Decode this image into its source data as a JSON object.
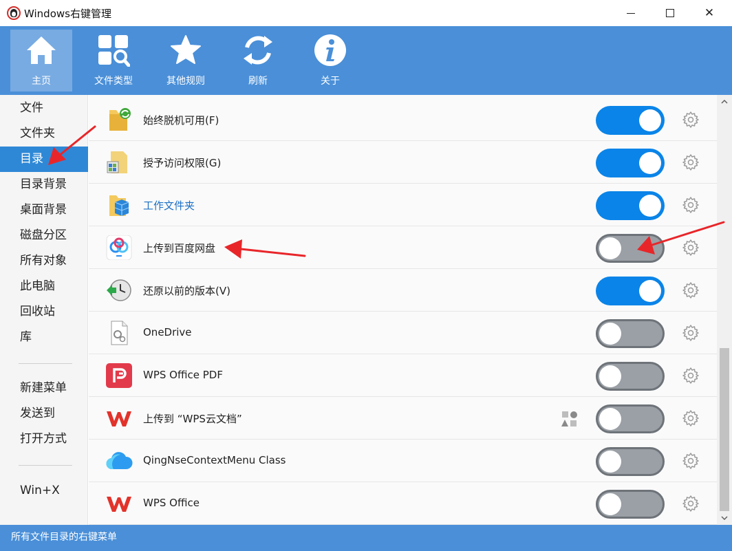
{
  "window": {
    "title": "Windows右键管理",
    "minimize_icon": "minimize-icon",
    "maximize_icon": "maximize-icon",
    "close_glyph": "✕"
  },
  "toolbar": {
    "items": [
      {
        "label": "主页",
        "icon": "home-icon",
        "active": true
      },
      {
        "label": "文件类型",
        "icon": "file-type-search-icon",
        "active": false
      },
      {
        "label": "其他规则",
        "icon": "star-icon",
        "active": false
      },
      {
        "label": "刷新",
        "icon": "refresh-icon",
        "active": false
      },
      {
        "label": "关于",
        "icon": "info-icon",
        "active": false
      }
    ]
  },
  "sidebar": {
    "items": [
      {
        "label": "文件",
        "active": false
      },
      {
        "label": "文件夹",
        "active": false
      },
      {
        "label": "目录",
        "active": true
      },
      {
        "label": "目录背景",
        "active": false
      },
      {
        "label": "桌面背景",
        "active": false
      },
      {
        "label": "磁盘分区",
        "active": false
      },
      {
        "label": "所有对象",
        "active": false
      },
      {
        "label": "此电脑",
        "active": false
      },
      {
        "label": "回收站",
        "active": false
      },
      {
        "label": "库",
        "active": false
      },
      {
        "label": "新建菜单",
        "active": false
      },
      {
        "label": "发送到",
        "active": false
      },
      {
        "label": "打开方式",
        "active": false
      },
      {
        "label": "Win+X",
        "active": false
      }
    ]
  },
  "list": {
    "rows": [
      {
        "label": "始终脱机可用(F)",
        "icon": "folder-sync-icon",
        "enabled": true
      },
      {
        "label": "授予访问权限(G)",
        "icon": "share-access-icon",
        "enabled": true
      },
      {
        "label": "工作文件夹",
        "icon": "work-folders-icon",
        "enabled": true
      },
      {
        "label": "上传到百度网盘",
        "icon": "baidu-netdisk-icon",
        "enabled": false
      },
      {
        "label": "还原以前的版本(V)",
        "icon": "restore-clock-icon",
        "enabled": true
      },
      {
        "label": "OneDrive",
        "icon": "onedrive-file-icon",
        "enabled": false
      },
      {
        "label": "WPS Office PDF",
        "icon": "wps-pdf-icon",
        "enabled": false
      },
      {
        "label": "上传到 “WPS云文档”",
        "icon": "wps-icon",
        "enabled": false,
        "extra_icon": "shapes-icon"
      },
      {
        "label": "QingNseContextMenu Class",
        "icon": "cloud-icon",
        "enabled": false
      },
      {
        "label": "WPS Office",
        "icon": "wps-icon",
        "enabled": false
      }
    ]
  },
  "status": {
    "text": "所有文件目录的右键菜单"
  },
  "colors": {
    "accent": "#4a8fd8",
    "toggle_on": "#0a84e8",
    "toggle_off": "#9aa0a6",
    "sidebar_active": "#2f88d6",
    "arrow": "#e8262a"
  }
}
